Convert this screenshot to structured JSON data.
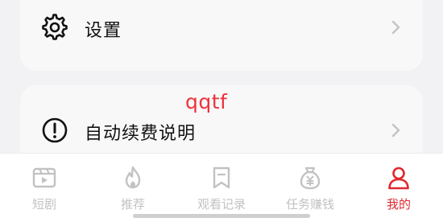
{
  "menu": {
    "settings_label": "设置",
    "auto_renew_label": "自动续费说明"
  },
  "watermark": "qqtf",
  "tabbar": {
    "tabs": [
      {
        "label": "短剧",
        "icon": "short-drama-icon",
        "active": false
      },
      {
        "label": "推荐",
        "icon": "flame-icon",
        "active": false
      },
      {
        "label": "观看记录",
        "icon": "bookmark-icon",
        "active": false
      },
      {
        "label": "任务赚钱",
        "icon": "money-bag-icon",
        "active": false
      },
      {
        "label": "我的",
        "icon": "person-icon",
        "active": true
      }
    ]
  },
  "colors": {
    "accent": "#e0282f",
    "inactive": "#c2c2c2",
    "card_bg": "#f8f8f8",
    "page_bg": "#f2f2f4"
  }
}
